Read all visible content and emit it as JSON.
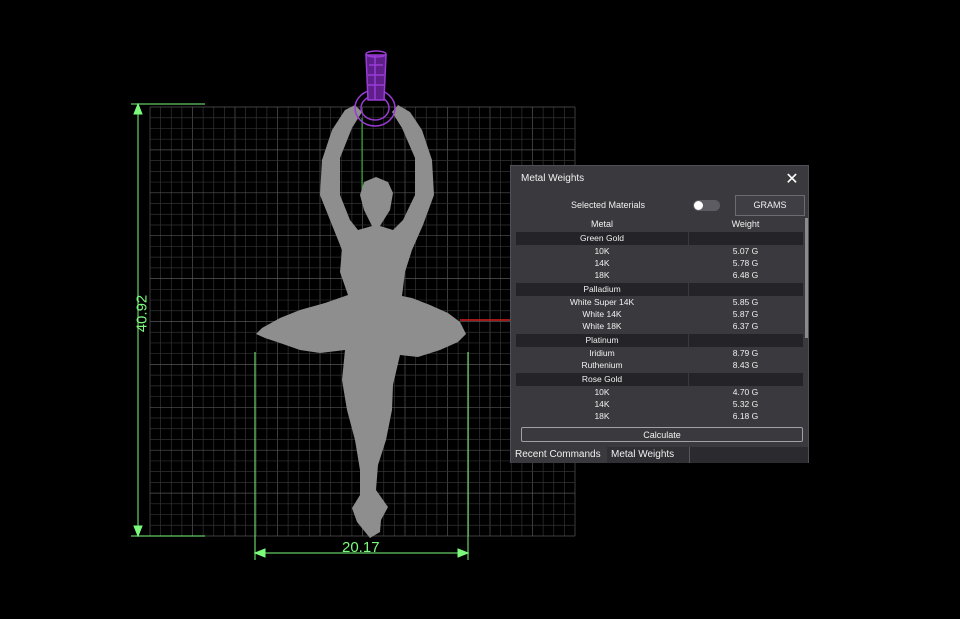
{
  "canvas": {
    "dimension_height": "40.92",
    "dimension_width": "20.17"
  },
  "panel": {
    "title": "Metal Weights",
    "close_icon": "close-icon",
    "selected_materials_label": "Selected Materials",
    "toggle_on": false,
    "units_button": "GRAMS",
    "col_metal": "Metal",
    "col_weight": "Weight",
    "groups": [
      {
        "name": "Green Gold",
        "rows": [
          {
            "metal": "10K",
            "weight": "5.07 G"
          },
          {
            "metal": "14K",
            "weight": "5.78 G"
          },
          {
            "metal": "18K",
            "weight": "6.48 G"
          }
        ]
      },
      {
        "name": "Palladium",
        "rows": [
          {
            "metal": "White Super 14K",
            "weight": "5.85 G"
          },
          {
            "metal": "White 14K",
            "weight": "5.87 G"
          },
          {
            "metal": "White 18K",
            "weight": "6.37 G"
          }
        ]
      },
      {
        "name": "Platinum",
        "rows": [
          {
            "metal": "Iridium",
            "weight": "8.79 G"
          },
          {
            "metal": "Ruthenium",
            "weight": "8.43 G"
          }
        ]
      },
      {
        "name": "Rose Gold",
        "rows": [
          {
            "metal": "10K",
            "weight": "4.70 G"
          },
          {
            "metal": "14K",
            "weight": "5.32 G"
          },
          {
            "metal": "18K",
            "weight": "6.18 G"
          }
        ]
      }
    ],
    "calculate_button": "Calculate",
    "tabs": [
      "Recent Commands",
      "Metal Weights"
    ]
  },
  "colors": {
    "dimension": "#7CFC7C",
    "grid": "#3d3d3d",
    "silhouette": "#8e8e8e",
    "bail": "#9a3bd6",
    "panel_bg": "#3a3a3e"
  }
}
